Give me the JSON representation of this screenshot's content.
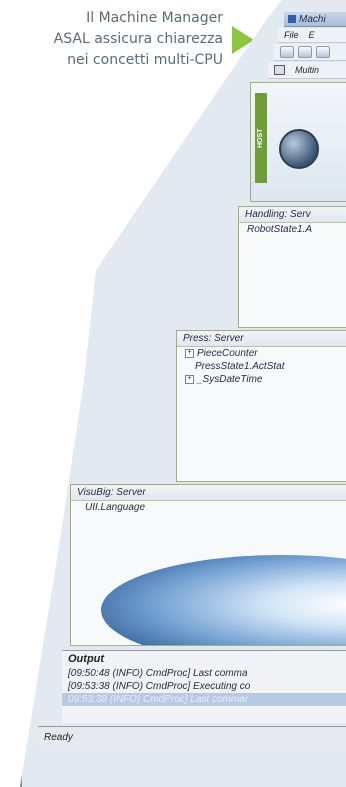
{
  "caption": {
    "lines": [
      "Il Machine Manager",
      "ASAL assicura chiarezza",
      "nei concetti multi-CPU"
    ]
  },
  "window": {
    "title": "Machi",
    "menu": [
      "File",
      "E"
    ],
    "tab_label": "Multin",
    "hero_tag": "HOST"
  },
  "panels": {
    "handling": {
      "title": "Handling: Serv",
      "rows": [
        "RobotState1.A"
      ]
    },
    "press": {
      "title": "Press: Server",
      "rows": [
        "PieceCounter",
        "PressState1.ActStat",
        "_SysDateTime"
      ]
    },
    "visubig": {
      "title": "VisuBig: Server",
      "rows": [
        "UII.Language"
      ]
    }
  },
  "output": {
    "title": "Output",
    "lines": [
      "[09:50:48 (INFO) CmdProc] Last comma",
      "[09:53:38 (INFO) CmdProc] Executing co",
      "09:53:38 (INFO) CmdProc] Last commar"
    ]
  },
  "status": {
    "text": "Ready"
  },
  "colors": {
    "accent_green": "#8cc63f",
    "caption": "#5a6b78"
  }
}
